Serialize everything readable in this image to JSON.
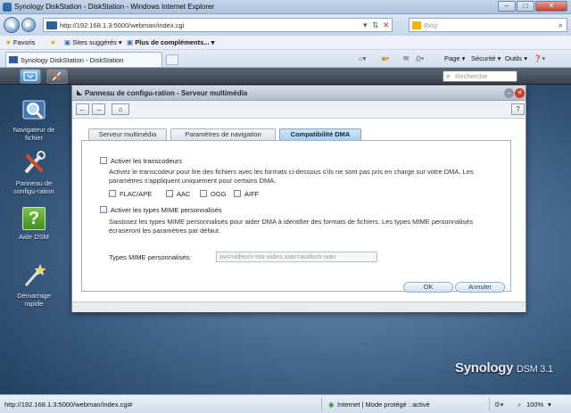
{
  "browser": {
    "window_title": "Synology DiskStation - DiskStation - Windows Internet Explorer",
    "url": "http://192.168.1.3:5000/webman/index.cgi",
    "search_placeholder": "Bing",
    "favorites": {
      "favoris": "Favoris",
      "suggested": "Sites suggérés ▾",
      "more_addons": "Plus de compléments... ▾"
    },
    "tab_title": "Synology DiskStation - DiskStation",
    "commands": {
      "page": "Page ▾",
      "security": "Sécurité ▾",
      "tools": "Outils ▾",
      "help": "❓▾"
    },
    "status": {
      "url": "http://192.168.1.3:5000/webman/index.cgi#",
      "zone": "Internet | Mode protégé : activé",
      "zoom": "100%"
    }
  },
  "dsm": {
    "search_placeholder": "Recherche",
    "desktop_icons": [
      {
        "label": "Navigateur de fichier",
        "icon": "magnifier-folder-icon"
      },
      {
        "label": "Panneau de configu-ration",
        "icon": "tools-icon"
      },
      {
        "label": "Aide DSM",
        "icon": "help-icon"
      },
      {
        "label": "Démarrage rapide",
        "icon": "wand-icon"
      }
    ],
    "brand": "Synology",
    "brand_suffix": "DSM 3.1"
  },
  "window": {
    "title": "Panneau de configu-ration - Serveur multimédia",
    "tabs": [
      {
        "label": "Serveur multimédia"
      },
      {
        "label": "Paramètres de navigation"
      },
      {
        "label": "Compatibilité DMA"
      }
    ],
    "transcoder": {
      "label": "Activer les transcodeurs",
      "description": "Activez le transcodeur pour lire des fichiers avec les formats ci-dessous s'ils ne sont pas pris en charge sur votre DMA. Les paramètres s'appliquent uniquement pour certains DMA.",
      "formats": [
        "FLAC/APE",
        "AAC",
        "OGG",
        "AIFF"
      ]
    },
    "mime": {
      "label": "Activer les types MIME personnalisés",
      "description": "Saisissez les types MIME personnalisés pour aider DMA à identifier des formats de fichiers. Les types MIME personnalisés écraseront les paramètres par défaut.",
      "field_label": "Types MIME personnalisés:",
      "field_value": "avi=video/x-ms-video,wav=audio/x-wav"
    },
    "ok_label": "OK",
    "cancel_label": "Annuler"
  }
}
